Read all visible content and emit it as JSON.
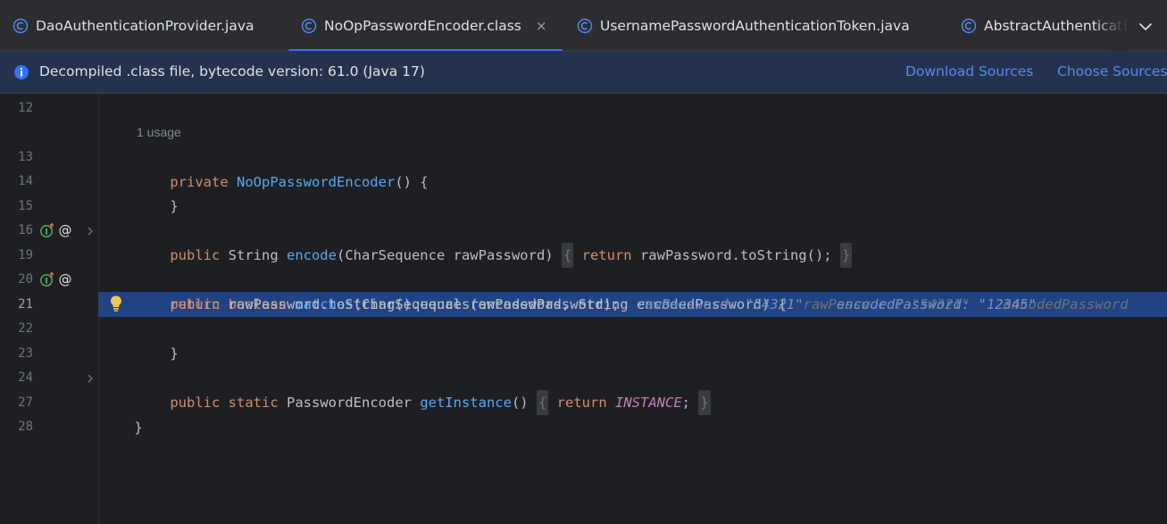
{
  "tabs": [
    {
      "label": "DaoAuthenticationProvider.java",
      "active": false
    },
    {
      "label": "NoOpPasswordEncoder.class",
      "active": true,
      "close": "×"
    },
    {
      "label": "UsernamePasswordAuthenticationToken.java",
      "active": false
    },
    {
      "label": "AbstractAuthenticati",
      "active": false
    }
  ],
  "banner": {
    "text": "Decompiled .class file, bytecode version: 61.0 (Java 17)",
    "download_sources": "Download Sources",
    "choose_sources": "Choose Sources"
  },
  "editor": {
    "line_numbers": [
      "12",
      "13",
      "14",
      "15",
      "16",
      "19",
      "20",
      "21",
      "22",
      "23",
      "24",
      "27",
      "28"
    ],
    "usage_hint": "1 usage",
    "code": {
      "l13": {
        "kw": "private",
        "fn": "NoOpPasswordEncoder",
        "rest": "() {"
      },
      "l14": "}",
      "l16": {
        "kw": "public",
        "t1": " String ",
        "fn": "encode",
        "t2": "(CharSequence rawPassword) ",
        "fold_open": "{",
        "ret": "return",
        "t3": " rawPassword.toString(); ",
        "fold_close": "}"
      },
      "l20": {
        "kw1": "public",
        "kw2": "boolean",
        "fn": "matches",
        "t1": "(CharSequence rawPassword, String encodedPassword) {",
        "hint1": "rawPassword: \"54321\"",
        "hint2": "encodedPassword"
      },
      "l21": {
        "ret": "return",
        "t1": " rawPassword.toString().equals(encodedPassword);",
        "hint1": "rawPassword: \"54321\"",
        "hint2": "encodedPassword: \"12345\""
      },
      "l22": "}",
      "l24": {
        "kw1": "public",
        "kw2": "static",
        "t1": " PasswordEncoder ",
        "fn": "getInstance",
        "t2": "() ",
        "fold_open": "{",
        "ret": "return",
        "st": "INSTANCE",
        "t3": "; ",
        "fold_close": "}"
      },
      "l27": "}"
    }
  },
  "colors": {
    "accent": "#3574f0",
    "link": "#548af7",
    "execution_line": "#214283",
    "keyword": "#cf8e6d",
    "function": "#56a8f5"
  },
  "icons": {
    "class_file": "class-c-icon",
    "info": "info-icon",
    "implementing": "implementing-method-icon",
    "annotation": "annotation-at-icon",
    "fold": "chevron-right-icon",
    "intention": "lightbulb-icon",
    "tabs_menu": "chevron-down-icon"
  }
}
